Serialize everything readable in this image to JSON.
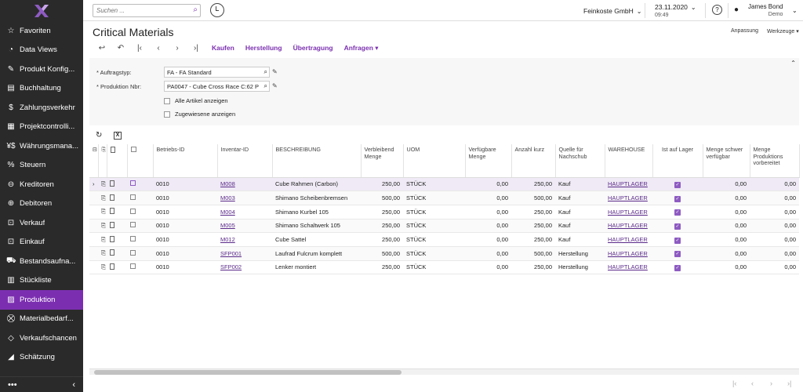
{
  "sidebar": {
    "items": [
      {
        "label": "Favoriten",
        "icon": "star-icon",
        "glyph": "☆"
      },
      {
        "label": "Data Views",
        "icon": "chart-icon",
        "glyph": "◔"
      },
      {
        "label": "Produkt Konfig...",
        "icon": "wrench-icon",
        "glyph": "✎"
      },
      {
        "label": "Buchhaltung",
        "icon": "ledger-icon",
        "glyph": "▤"
      },
      {
        "label": "Zahlungsverkehr",
        "icon": "dollar-icon",
        "glyph": "$"
      },
      {
        "label": "Projektcontrolli...",
        "icon": "project-icon",
        "glyph": "▦"
      },
      {
        "label": "Währungsmana...",
        "icon": "currency-icon",
        "glyph": "¥$"
      },
      {
        "label": "Steuern",
        "icon": "percent-icon",
        "glyph": "%"
      },
      {
        "label": "Kreditoren",
        "icon": "minus-circle-icon",
        "glyph": "⊖"
      },
      {
        "label": "Debitoren",
        "icon": "plus-circle-icon",
        "glyph": "⊕"
      },
      {
        "label": "Verkauf",
        "icon": "cart-in-icon",
        "glyph": "⊡"
      },
      {
        "label": "Einkauf",
        "icon": "cart-out-icon",
        "glyph": "⊡"
      },
      {
        "label": "Bestandsaufna...",
        "icon": "truck-icon",
        "glyph": "⛟"
      },
      {
        "label": "Stückliste",
        "icon": "list-icon",
        "glyph": "▥"
      },
      {
        "label": "Produktion",
        "icon": "production-icon",
        "glyph": "▨",
        "active": true
      },
      {
        "label": "Materialbedarf...",
        "icon": "cart-icon",
        "glyph": "⛒"
      },
      {
        "label": "Verkaufschancen",
        "icon": "tag-icon",
        "glyph": "◇"
      },
      {
        "label": "Schätzung",
        "icon": "estimate-icon",
        "glyph": "◢"
      }
    ],
    "footer_more": "•••",
    "footer_collapse": "‹"
  },
  "topbar": {
    "search_placeholder": "Suchen ...",
    "company": "Feinkoste GmbH",
    "date": "23.11.2020",
    "time": "09:49",
    "user_name": "James Bond",
    "user_role": "Demo",
    "help": "?"
  },
  "page": {
    "title": "Critical Materials",
    "anpassung": "Anpassung",
    "werkzeuge": "Werkzeuge"
  },
  "toolbar": {
    "actions": [
      "Kaufen",
      "Herstellung",
      "Übertragung",
      "Anfragen"
    ]
  },
  "form": {
    "auftragstyp_label": "* Auftragstyp:",
    "auftragstyp_value": "FA - FA Standard",
    "produktion_label": "* Produktion Nbr:",
    "produktion_value": "PA0047 - Cube Cross Race C:62 P",
    "alle_artikel": "Alle Artikel anzeigen",
    "zugewiesene": "Zugewiesene anzeigen"
  },
  "grid": {
    "headers": [
      "Betriebs-ID",
      "Inventar-ID",
      "BESCHREIBUNG",
      "Verbleibend Menge",
      "UOM",
      "Verfügbare Menge",
      "Anzahl kurz",
      "Quelle für Nachschub",
      "WAREHOUSE",
      "Ist auf Lager",
      "Menge schwer verfügbar",
      "Menge Produktions vorbereitet"
    ],
    "rows": [
      {
        "betriebs": "0010",
        "inventar": "M008",
        "beschreibung": "Cube Rahmen (Carbon)",
        "verbleibend": "250,00",
        "uom": "STÜCK",
        "verfuegbar": "0,00",
        "kurz": "250,00",
        "quelle": "Kauf",
        "warehouse": "HAUPTLAGER",
        "schwer": "0,00",
        "vorbereitet": "0,00"
      },
      {
        "betriebs": "0010",
        "inventar": "M003",
        "beschreibung": "Shimano Scheibenbremsen",
        "verbleibend": "500,00",
        "uom": "STÜCK",
        "verfuegbar": "0,00",
        "kurz": "500,00",
        "quelle": "Kauf",
        "warehouse": "HAUPTLAGER",
        "schwer": "0,00",
        "vorbereitet": "0,00"
      },
      {
        "betriebs": "0010",
        "inventar": "M004",
        "beschreibung": "Shimano Kurbel 105",
        "verbleibend": "250,00",
        "uom": "STÜCK",
        "verfuegbar": "0,00",
        "kurz": "250,00",
        "quelle": "Kauf",
        "warehouse": "HAUPTLAGER",
        "schwer": "0,00",
        "vorbereitet": "0,00"
      },
      {
        "betriebs": "0010",
        "inventar": "M005",
        "beschreibung": "Shimano Schaltwerk 105",
        "verbleibend": "250,00",
        "uom": "STÜCK",
        "verfuegbar": "0,00",
        "kurz": "250,00",
        "quelle": "Kauf",
        "warehouse": "HAUPTLAGER",
        "schwer": "0,00",
        "vorbereitet": "0,00"
      },
      {
        "betriebs": "0010",
        "inventar": "M012",
        "beschreibung": "Cube Sattel",
        "verbleibend": "250,00",
        "uom": "STÜCK",
        "verfuegbar": "0,00",
        "kurz": "250,00",
        "quelle": "Kauf",
        "warehouse": "HAUPTLAGER",
        "schwer": "0,00",
        "vorbereitet": "0,00"
      },
      {
        "betriebs": "0010",
        "inventar": "SFP001",
        "beschreibung": "Laufrad Fulcrum komplett",
        "verbleibend": "500,00",
        "uom": "STÜCK",
        "verfuegbar": "0,00",
        "kurz": "500,00",
        "quelle": "Herstellung",
        "warehouse": "HAUPTLAGER",
        "schwer": "0,00",
        "vorbereitet": "0,00"
      },
      {
        "betriebs": "0010",
        "inventar": "SFP002",
        "beschreibung": "Lenker montiert",
        "verbleibend": "250,00",
        "uom": "STÜCK",
        "verfuegbar": "0,00",
        "kurz": "250,00",
        "quelle": "Herstellung",
        "warehouse": "HAUPTLAGER",
        "schwer": "0,00",
        "vorbereitet": "0,00"
      }
    ]
  },
  "colors": {
    "accent": "#7b2fb0",
    "sidebar": "#2a2a2a"
  }
}
